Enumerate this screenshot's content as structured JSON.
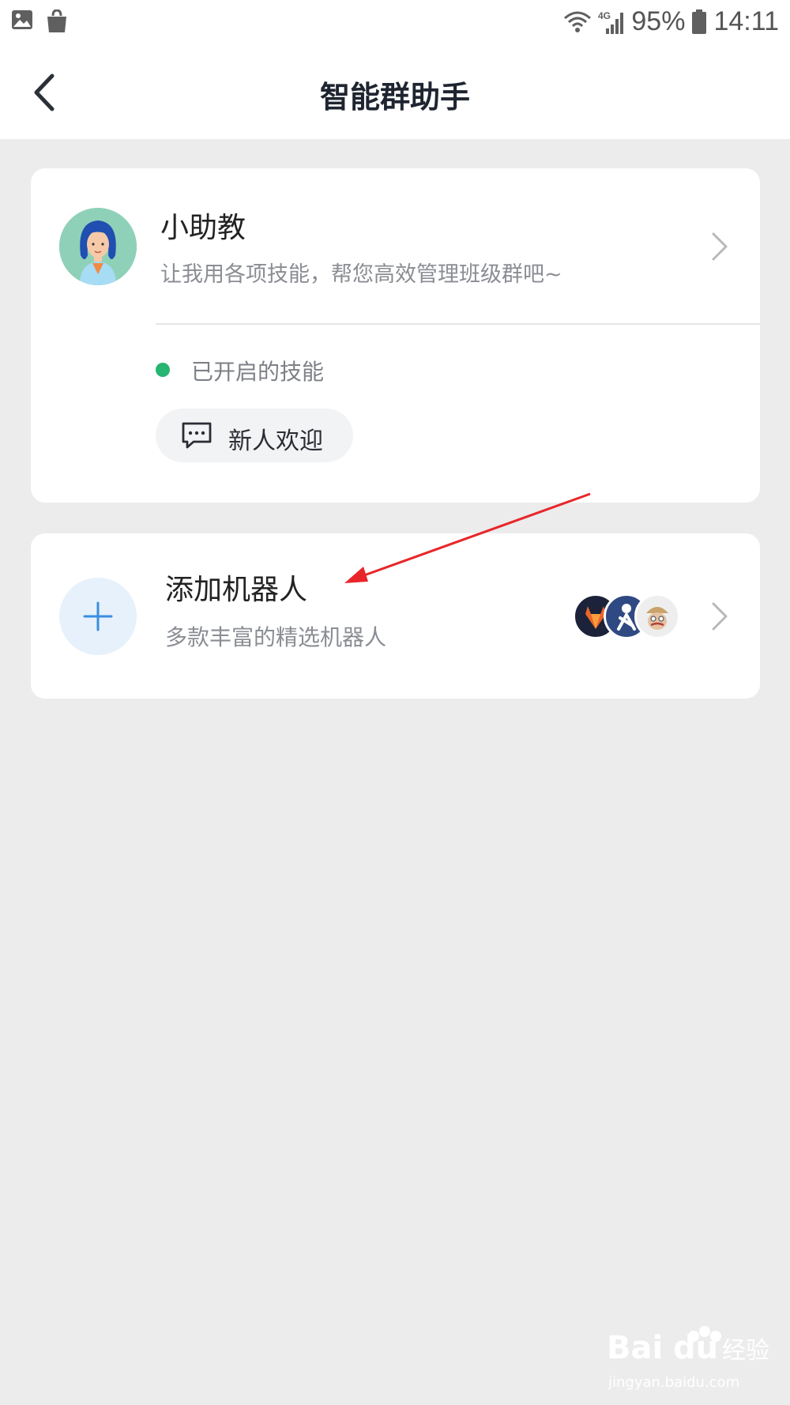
{
  "status_bar": {
    "battery": "95%",
    "time": "14:11",
    "network": "4G",
    "icons": [
      "gallery-icon",
      "shopping-bag-icon",
      "wifi-icon",
      "signal-icon",
      "battery-icon"
    ]
  },
  "header": {
    "title": "智能群助手",
    "back_icon": "back-arrow-icon"
  },
  "assistant_card": {
    "name": "小助教",
    "description": "让我用各项技能，帮您高效管理班级群吧~",
    "skills_label": "已开启的技能",
    "status_color": "#27b572",
    "skills": [
      {
        "label": "新人欢迎",
        "icon": "chat-bubble-icon"
      }
    ]
  },
  "robots_card": {
    "title": "添加机器人",
    "description": "多款丰富的精选机器人",
    "add_icon": "plus-icon",
    "bot_icons": [
      "gitlab-bot-icon",
      "jenkins-bot-icon",
      "travis-bot-icon"
    ]
  },
  "annotation": {
    "color": "#e8262a",
    "icon": "red-arrow-annotation"
  },
  "watermark": {
    "brand": "Bai",
    "brand_suffix": "du",
    "label": "经验",
    "url": "jingyan.baidu.com"
  }
}
